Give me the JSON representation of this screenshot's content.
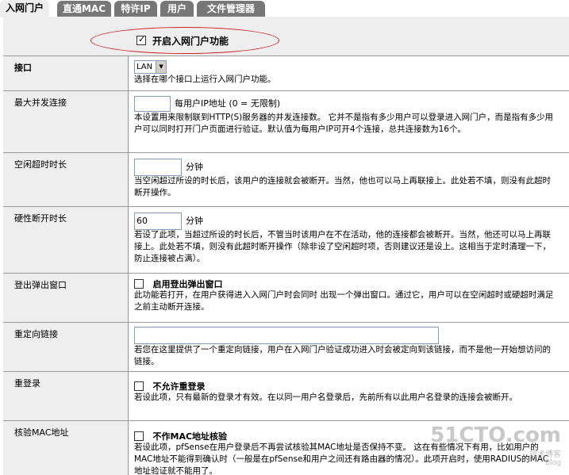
{
  "tabs": [
    "入网门户",
    "直通MAC",
    "特许IP",
    "用户",
    "文件管理器"
  ],
  "enable_portal": {
    "label": "开启入网门户功能",
    "checked": true
  },
  "interface": {
    "label": "接口",
    "selected": "LAN",
    "desc": "选择在哪个接口上运行入网门户功能。"
  },
  "max_conn": {
    "label": "最大并发连接",
    "value": "",
    "unit": "每用户IP地址 (0 = 无限制)",
    "desc": "本设置用来限制联到HTTP(S)服务器的并发连接数。 它并不是指有多少用户可以登录进入网门户，而是指有多少用户可以同时打开门户页面进行验证。默认值为每用户IP可开4个连接，总共连接数为16个。"
  },
  "idle_timeout": {
    "label": "空闲超时时长",
    "value": "",
    "unit": "分钟",
    "desc": "当空闲超过所设的时长后，该用户的连接就会被断开。当然，他也可以马上再联接上。此处若不填，则没有此超时断开操作。"
  },
  "hard_timeout": {
    "label": "硬性断开时长",
    "value": "60",
    "unit": "分钟",
    "desc": "若设了此项，当超过所设的时长后，不管当时该用户在不在活动，他的连接都会被断开。当然，他还可以马上再联接上。此处若不填，则没有此超时断开操作（除非设了空闲超时项，否则建议还是设上。这相当于定时清理一下，防止连接被占满）。"
  },
  "logout_popup": {
    "label": "登出弹出窗口",
    "check_label": "启用登出弹出窗口",
    "checked": false,
    "desc": "此功能若打开，在用户获得进入入网门户时会同时 出现一个弹出窗口。通过它，用户可以在空闲超时或硬超时满足之前主动断开连接。"
  },
  "redirect": {
    "label": "重定向链接",
    "value": "",
    "desc": "若您在这里提供了一个重定向链接，用户在入网门户验证成功进入时会被定向到该链接，而不是他一开始想访问的链接。"
  },
  "relogin": {
    "label": "重登录",
    "check_label": "不允许重登录",
    "checked": false,
    "desc": "若设此项，只有最新的登录才有效。在以同一用户名登录后，先前所有以此用户名登录的连接会被断开。"
  },
  "mac_check": {
    "label": "核验MAC地址",
    "check_label": "不作MAC地址核验",
    "checked": false,
    "desc": "若设此项，pfSense在用户登录后不再尝试核验其MAC地址是否保持不变。 这在有些情况下有用，比如用户的MAC地址不能得到确认时（一般是在pfSense和用户之间还有路由器的情况）。此项开启时，使用RADIUS的MAC地址验证就不能用了。"
  },
  "watermark": {
    "main": "51CTO.com",
    "sub": "技术博客",
    "sub2": "Blog"
  }
}
